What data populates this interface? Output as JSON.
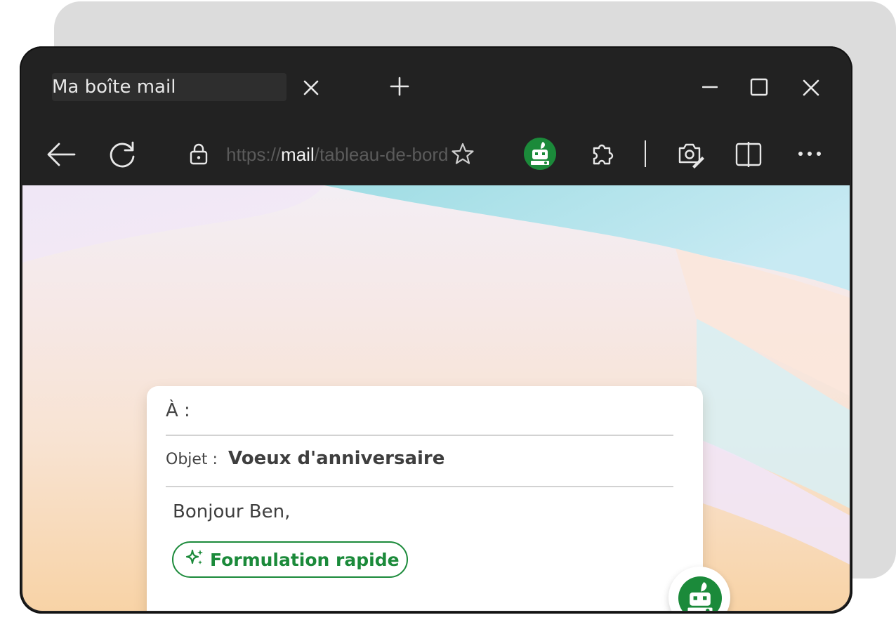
{
  "browser": {
    "tab_title": "Ma boîte mail",
    "url_prefix": "https://",
    "url_host": "mail",
    "url_path": "/tableau-de-bord"
  },
  "compose": {
    "to_label": "À :",
    "subject_label": "Objet :",
    "subject_value": "Voeux d'anniversaire",
    "body_greeting": "Bonjour Ben,",
    "quick_action_label": "Formulation rapide"
  },
  "colors": {
    "accent": "#1b8a3a",
    "chrome": "#222222"
  }
}
